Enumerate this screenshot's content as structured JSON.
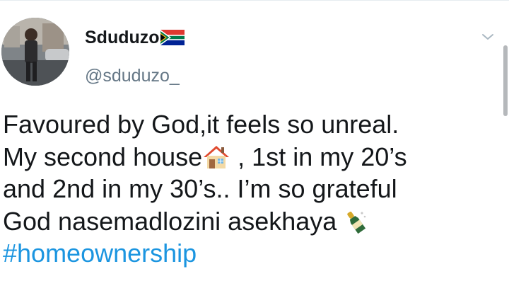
{
  "tweet": {
    "author": {
      "display_name": "Sduduzo",
      "flag_icon": "south-africa-flag-icon",
      "handle": "@sduduzo_",
      "avatar_icon": "user-avatar-photo"
    },
    "menu_icon": "chevron-down-icon",
    "text_lines": {
      "line1": "Favoured by God,it feels so unreal.",
      "line2_before_emoji": "My second house",
      "line2_after_emoji": " , 1st in my 20’s",
      "line3": "and 2nd in my 30’s.. I’m so grateful",
      "line4": "God nasemadlozini asekhaya "
    },
    "emojis": {
      "house": "house-icon",
      "champagne": "champagne-bottle-icon"
    },
    "hashtag": "#homeownership",
    "colors": {
      "text": "#14171a",
      "secondary": "#657786",
      "link": "#1b95e0"
    }
  }
}
